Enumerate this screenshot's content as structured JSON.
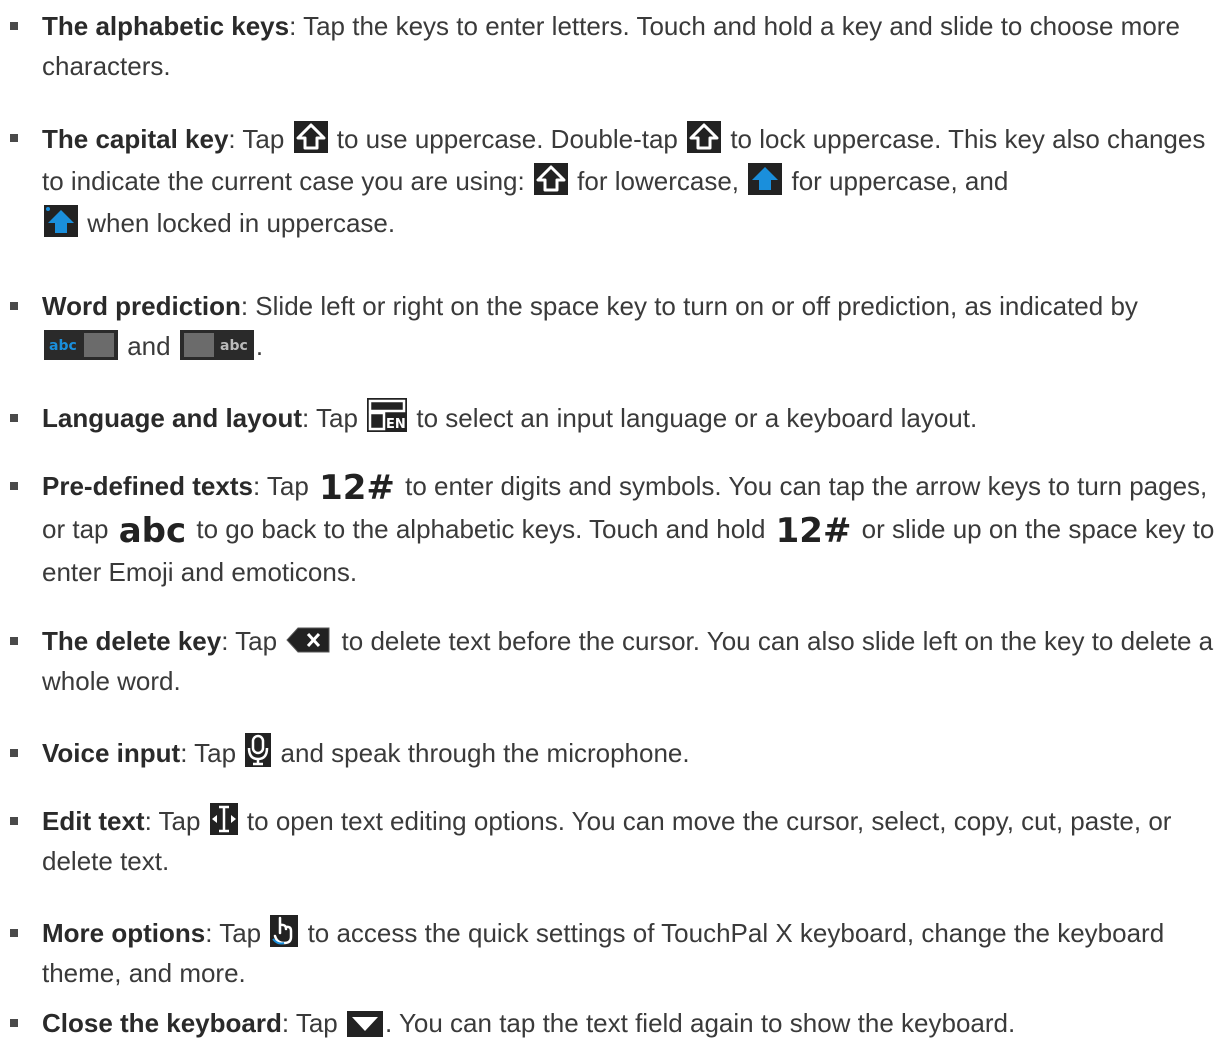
{
  "colors": {
    "text": "#3a3a3a",
    "bullet": "#4a4a4a",
    "icon_dark": "#222222",
    "icon_blue": "#1a8fdc",
    "key_gray": "#6b6b6b"
  },
  "items": [
    {
      "term": "The alphabetic keys",
      "parts": [
        ": Tap the keys to enter letters. Touch and hold a key and slide to choose more characters."
      ]
    },
    {
      "term": "The capital key",
      "parts": [
        ": Tap ",
        " to use uppercase. Double-tap ",
        " to lock uppercase. This key also changes to indicate the current case you are using: ",
        " for lowercase, ",
        " for uppercase, and ",
        " when locked in uppercase."
      ],
      "icons": [
        "shift-outline-icon",
        "shift-outline-icon",
        "shift-outline-icon",
        "shift-filled-blue-icon",
        "shift-locked-blue-icon"
      ]
    },
    {
      "term": "Word prediction",
      "parts": [
        ": Slide left or right on the space key to turn on or off prediction, as indicated by ",
        " and ",
        "."
      ],
      "icons": [
        "prediction-on-icon",
        "prediction-off-icon"
      ],
      "icon_text": "abc"
    },
    {
      "term": "Language and layout",
      "parts": [
        ": Tap ",
        " to select an input language or a keyboard layout."
      ],
      "icons": [
        "language-layout-icon"
      ],
      "icon_text": "EN"
    },
    {
      "term": "Pre-defined texts",
      "parts": [
        ": Tap ",
        " to enter digits and symbols. You can tap the arrow keys to turn pages, or tap ",
        " to go back to the alphabetic keys. Touch and hold ",
        " or slide up on the space key to enter Emoji and emoticons."
      ],
      "icons": [
        "digits-symbols-icon",
        "abc-icon",
        "digits-symbols-icon"
      ],
      "icon_texts": [
        "12#",
        "abc",
        "12#"
      ]
    },
    {
      "term": "The delete key",
      "parts": [
        ": Tap ",
        " to delete text before the cursor. You can also slide left on the key to delete a whole word."
      ],
      "icons": [
        "delete-key-icon"
      ]
    },
    {
      "term": "Voice input",
      "parts": [
        ": Tap ",
        " and speak through the microphone."
      ],
      "icons": [
        "microphone-icon"
      ]
    },
    {
      "term": "Edit text",
      "parts": [
        ": Tap ",
        " to open text editing options. You can move the cursor, select, copy, cut, paste, or delete text."
      ],
      "icons": [
        "text-cursor-icon"
      ]
    },
    {
      "term": "More options",
      "parts": [
        ": Tap ",
        " to access the quick settings of TouchPal X keyboard, change the keyboard theme, and more."
      ],
      "icons": [
        "more-options-hand-icon"
      ]
    },
    {
      "term": "Close the keyboard",
      "parts": [
        ": Tap ",
        ". You can tap the text field again to show the keyboard."
      ],
      "icons": [
        "close-keyboard-icon"
      ]
    }
  ]
}
